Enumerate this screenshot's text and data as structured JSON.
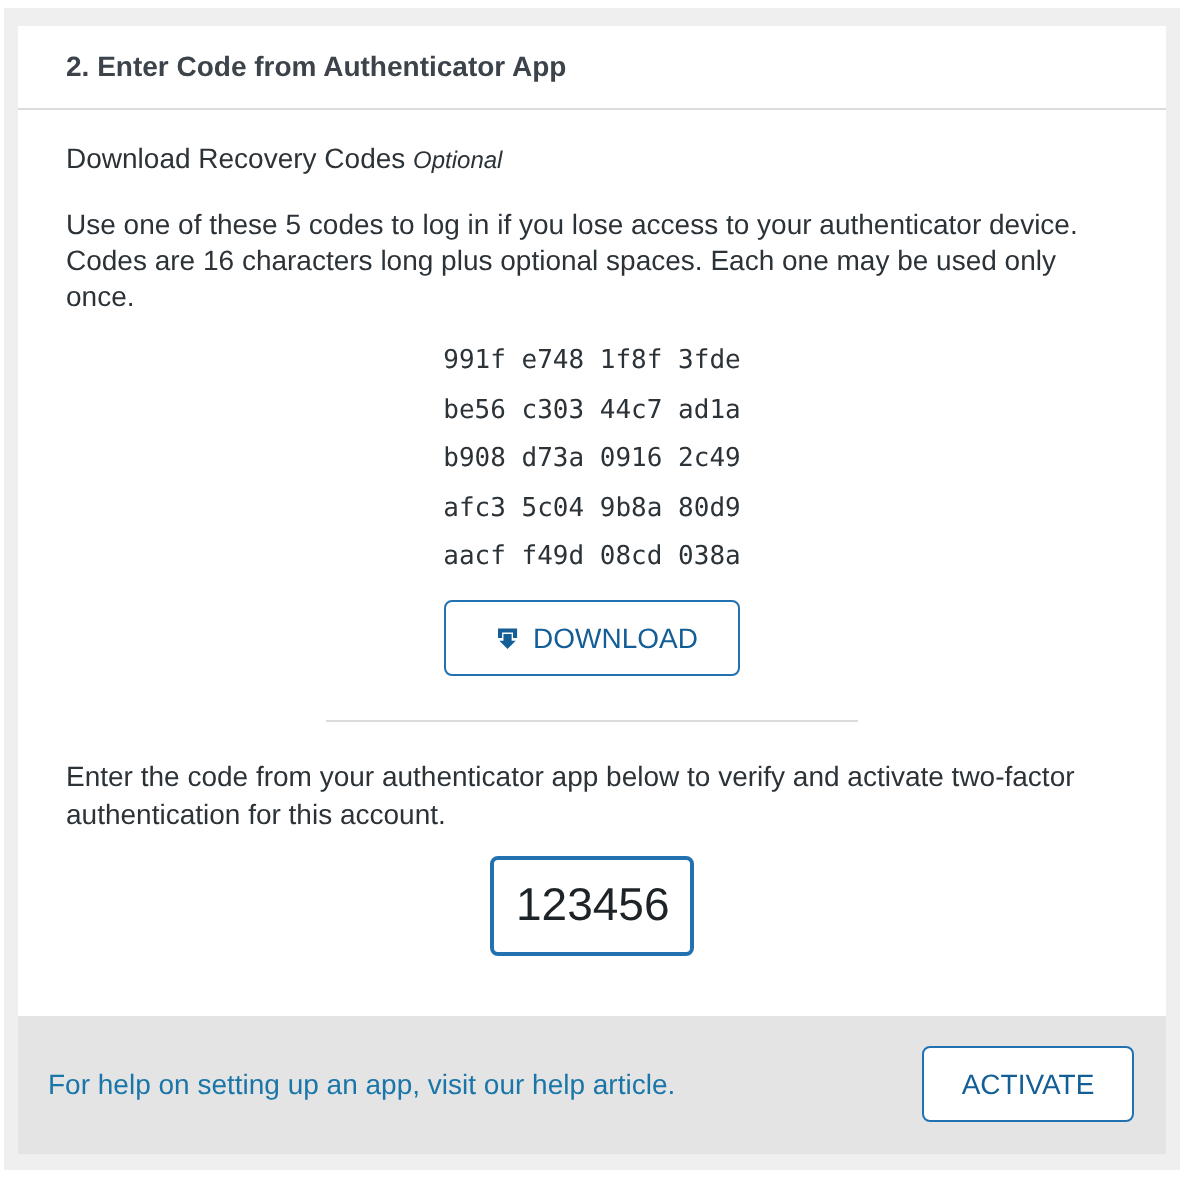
{
  "section": {
    "title": "2. Enter Code from Authenticator App"
  },
  "recovery": {
    "heading": "Download Recovery Codes",
    "tag": "Optional",
    "description": "Use one of these 5 codes to log in if you lose access to your authenticator device. Codes are 16 characters long plus optional spaces. Each one may be used only once.",
    "codes": [
      "991f e748 1f8f 3fde",
      "be56 c303 44c7 ad1a",
      "b908 d73a 0916 2c49",
      "afc3 5c04 9b8a 80d9",
      "aacf f49d 08cd 038a"
    ],
    "download_button": "DOWNLOAD"
  },
  "verify": {
    "instruction": "Enter the code from your authenticator app below to verify and activate two-factor authentication for this account.",
    "code_value": "123456"
  },
  "footer": {
    "help_link": "For help on setting up an app, visit our help article.",
    "activate_button": "ACTIVATE"
  }
}
